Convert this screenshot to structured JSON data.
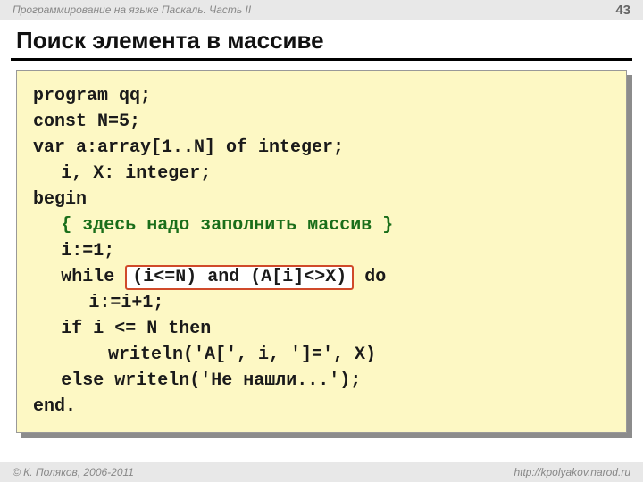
{
  "header": {
    "series": "Программирование на языке Паскаль. Часть II",
    "page": "43"
  },
  "title": "Поиск элемента в массиве",
  "code": {
    "l1": "program qq;",
    "l2": "const N=5;",
    "l3": "var a:array[1..N] of integer;",
    "l4": "i, X: integer;",
    "l5": "begin",
    "l6": "{ здесь надо заполнить массив }",
    "l7": "i:=1;",
    "l8a": "while ",
    "l8hl": "(i<=N) and (A[i]<>X)",
    "l8b": " do",
    "l9": "i:=i+1;",
    "l10": "if i <= N then",
    "l11": "writeln('A[', i, ']=', X)",
    "l12": "else writeln('Не нашли...');",
    "l13": "end."
  },
  "footer": {
    "copyright": "© К. Поляков, 2006-2011",
    "url": "http://kpolyakov.narod.ru"
  }
}
